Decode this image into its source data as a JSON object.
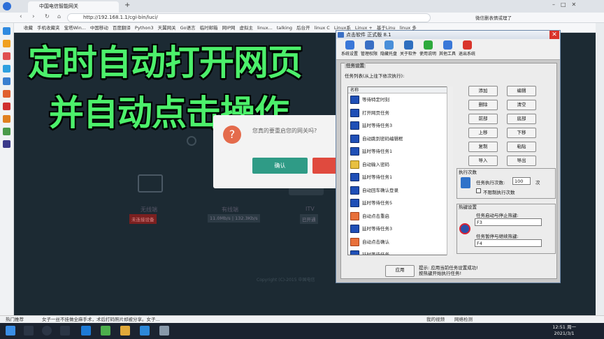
{
  "browser": {
    "tab_title": "中国电信智能网关",
    "url": "http://192.168.1.1/cgi-bin/luci/",
    "search_hint": "微信删表情或理了",
    "bookmarks": [
      "收藏",
      "手机收藏夹",
      "宝塔Win...",
      "中国移动",
      "百度翻译",
      "Python3",
      "天翼网关",
      "Go语言",
      "临时邮箱",
      "网IP网",
      "虚拟主",
      "linux...",
      "talking",
      "后台开",
      "linux C",
      "Linux系",
      "Linux +",
      "基于Linu",
      "linux 多"
    ]
  },
  "overlay": {
    "line1": "定时自动打开网页",
    "line2": "并自动点击操作"
  },
  "web_dialog": {
    "message": "您真的要重启您的网关吗?",
    "confirm": "确认"
  },
  "devices": [
    {
      "label": "无线端",
      "value": "未连接设备"
    },
    {
      "label": "有线端",
      "value": "11.0Mb/s | 132.3Kb/s"
    },
    {
      "label": "ITV",
      "value": "已开通"
    }
  ],
  "copyright": "Copyright (C)-2015 中国电信",
  "app": {
    "title": "点击软件 正式版 8.1",
    "toolbar": [
      "系统设置",
      "管理权限",
      "隐藏托盘",
      "关于软件",
      "使用说明",
      "其他工具",
      "退出系统"
    ],
    "group_label": "任务设置",
    "list_label": "任务列表(从上往下依次执行):",
    "list_header": "名称",
    "tasks": [
      "等待特定时刻",
      "打开网页任务",
      "延时等待任务3",
      "自动跳到密码编辑框",
      "延时等待任务1",
      "自动输入密码",
      "延时等待任务1",
      "自动回车确认登录",
      "延时等待任务5",
      "自动点击重启",
      "延时等待任务3",
      "自动点击确认",
      "延时等待任务..."
    ],
    "buttons_left": [
      "添加",
      "删除",
      "前部",
      "上移",
      "复制",
      "导入"
    ],
    "buttons_right": [
      "编辑",
      "清空",
      "底部",
      "下移",
      "粘贴",
      "导出"
    ],
    "exec_label": "执行次数",
    "exec_count_label": "任务执行次数:",
    "exec_count": "100",
    "exec_unit": "次",
    "unlimited_label": "不限制执行次数",
    "hotkey_label": "热键设置",
    "hotkey_start_label": "任务启动与停止热键:",
    "hotkey_start": "F3",
    "hotkey_pause_label": "任务暂停与继续热键:",
    "hotkey_pause": "F4",
    "apply": "应用",
    "hint_line1": "提示: 应用当前任务设置成功!",
    "hint_line2": "按热键开始执行任务!"
  },
  "statusbar": {
    "left": "热门推荐",
    "news": "女子一丝不挂做全麻手术，术后打码照片却被分享。女子...",
    "right1": "我的视频",
    "right2": "网络检测"
  },
  "clock": {
    "time": "12:51 周一",
    "date": "2021/3/1"
  }
}
